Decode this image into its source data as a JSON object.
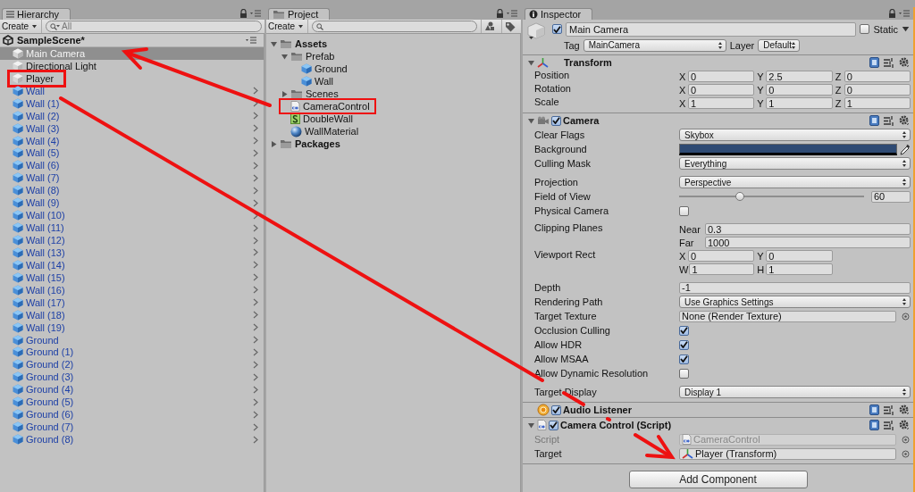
{
  "hierarchy": {
    "tab": "Hierarchy",
    "create": "Create",
    "search": {
      "placeholder": "All"
    },
    "scene": "SampleScene*",
    "items": [
      {
        "name": "Main Camera",
        "kind": "object",
        "selected": true,
        "highlighted": false
      },
      {
        "name": "Directional Light",
        "kind": "object",
        "selected": false,
        "highlighted": false
      },
      {
        "name": "Player",
        "kind": "object",
        "selected": false,
        "highlighted": true
      },
      {
        "name": "Wall",
        "kind": "prefab",
        "selected": false,
        "highlighted": false
      },
      {
        "name": "Wall (1)",
        "kind": "prefab",
        "selected": false,
        "highlighted": false
      },
      {
        "name": "Wall (2)",
        "kind": "prefab",
        "selected": false,
        "highlighted": false
      },
      {
        "name": "Wall (3)",
        "kind": "prefab",
        "selected": false,
        "highlighted": false
      },
      {
        "name": "Wall (4)",
        "kind": "prefab",
        "selected": false,
        "highlighted": false
      },
      {
        "name": "Wall (5)",
        "kind": "prefab",
        "selected": false,
        "highlighted": false
      },
      {
        "name": "Wall (6)",
        "kind": "prefab",
        "selected": false,
        "highlighted": false
      },
      {
        "name": "Wall (7)",
        "kind": "prefab",
        "selected": false,
        "highlighted": false
      },
      {
        "name": "Wall (8)",
        "kind": "prefab",
        "selected": false,
        "highlighted": false
      },
      {
        "name": "Wall (9)",
        "kind": "prefab",
        "selected": false,
        "highlighted": false
      },
      {
        "name": "Wall (10)",
        "kind": "prefab",
        "selected": false,
        "highlighted": false
      },
      {
        "name": "Wall (11)",
        "kind": "prefab",
        "selected": false,
        "highlighted": false
      },
      {
        "name": "Wall (12)",
        "kind": "prefab",
        "selected": false,
        "highlighted": false
      },
      {
        "name": "Wall (13)",
        "kind": "prefab",
        "selected": false,
        "highlighted": false
      },
      {
        "name": "Wall (14)",
        "kind": "prefab",
        "selected": false,
        "highlighted": false
      },
      {
        "name": "Wall (15)",
        "kind": "prefab",
        "selected": false,
        "highlighted": false
      },
      {
        "name": "Wall (16)",
        "kind": "prefab",
        "selected": false,
        "highlighted": false
      },
      {
        "name": "Wall (17)",
        "kind": "prefab",
        "selected": false,
        "highlighted": false
      },
      {
        "name": "Wall (18)",
        "kind": "prefab",
        "selected": false,
        "highlighted": false
      },
      {
        "name": "Wall (19)",
        "kind": "prefab",
        "selected": false,
        "highlighted": false
      },
      {
        "name": "Ground",
        "kind": "prefab",
        "selected": false,
        "highlighted": false
      },
      {
        "name": "Ground (1)",
        "kind": "prefab",
        "selected": false,
        "highlighted": false
      },
      {
        "name": "Ground (2)",
        "kind": "prefab",
        "selected": false,
        "highlighted": false
      },
      {
        "name": "Ground (3)",
        "kind": "prefab",
        "selected": false,
        "highlighted": false
      },
      {
        "name": "Ground (4)",
        "kind": "prefab",
        "selected": false,
        "highlighted": false
      },
      {
        "name": "Ground (5)",
        "kind": "prefab",
        "selected": false,
        "highlighted": false
      },
      {
        "name": "Ground (6)",
        "kind": "prefab",
        "selected": false,
        "highlighted": false
      },
      {
        "name": "Ground (7)",
        "kind": "prefab",
        "selected": false,
        "highlighted": false
      },
      {
        "name": "Ground (8)",
        "kind": "prefab",
        "selected": false,
        "highlighted": false
      }
    ]
  },
  "project": {
    "tab": "Project",
    "create": "Create",
    "tree": [
      {
        "name": "Assets",
        "kind": "folder",
        "expanded": true,
        "highlighted": false,
        "children": [
          {
            "name": "Prefab",
            "kind": "folder",
            "expanded": true,
            "highlighted": false,
            "children": [
              {
                "name": "Ground",
                "kind": "prefab",
                "highlighted": false
              },
              {
                "name": "Wall",
                "kind": "prefab",
                "highlighted": false
              }
            ]
          },
          {
            "name": "Scenes",
            "kind": "folder",
            "expanded": false,
            "highlighted": false
          },
          {
            "name": "CameraControl",
            "kind": "csharp",
            "highlighted": true
          },
          {
            "name": "DoubleWall",
            "kind": "script",
            "highlighted": false
          },
          {
            "name": "WallMaterial",
            "kind": "material",
            "highlighted": false
          }
        ]
      },
      {
        "name": "Packages",
        "kind": "folder",
        "expanded": false,
        "highlighted": false
      }
    ]
  },
  "inspector": {
    "tab": "Inspector",
    "object": {
      "active": true,
      "name": "Main Camera",
      "static": false,
      "static_label": "Static",
      "tag_label": "Tag",
      "tag": "MainCamera",
      "layer_label": "Layer",
      "layer": "Default"
    },
    "components": [
      {
        "kind": "transform",
        "title": "Transform",
        "expanded": true,
        "rows": [
          {
            "kind": "vector",
            "label": "Position",
            "lines": [
              [
                {
                  "axis": "X",
                  "value": "0"
                },
                {
                  "axis": "Y",
                  "value": "2.5"
                },
                {
                  "axis": "Z",
                  "value": "0"
                }
              ]
            ]
          },
          {
            "kind": "vector",
            "label": "Rotation",
            "lines": [
              [
                {
                  "axis": "X",
                  "value": "0"
                },
                {
                  "axis": "Y",
                  "value": "0"
                },
                {
                  "axis": "Z",
                  "value": "0"
                }
              ]
            ]
          },
          {
            "kind": "vector",
            "label": "Scale",
            "lines": [
              [
                {
                  "axis": "X",
                  "value": "1"
                },
                {
                  "axis": "Y",
                  "value": "1"
                },
                {
                  "axis": "Z",
                  "value": "1"
                }
              ]
            ]
          }
        ]
      },
      {
        "kind": "camera",
        "title": "Camera",
        "enabled": true,
        "expanded": true,
        "rows": [
          {
            "kind": "dropdown",
            "label": "Clear Flags",
            "value": "Skybox"
          },
          {
            "kind": "color",
            "label": "Background",
            "color": "#2e4a73"
          },
          {
            "kind": "dropdown",
            "label": "Culling Mask",
            "value": "Everything"
          },
          {
            "kind": "space"
          },
          {
            "kind": "dropdown",
            "label": "Projection",
            "value": "Perspective"
          },
          {
            "kind": "slider",
            "label": "Field of View",
            "level": 0.33,
            "value": "60"
          },
          {
            "kind": "checkbox",
            "label": "Physical Camera",
            "checked": false
          },
          {
            "kind": "space"
          },
          {
            "kind": "vector",
            "label": "Clipping Planes",
            "lines": [
              [
                {
                  "axis": "Near",
                  "value": "0.3"
                }
              ],
              [
                {
                  "axis": "Far",
                  "value": "1000"
                }
              ]
            ]
          },
          {
            "kind": "vector",
            "label": "Viewport Rect",
            "lines": [
              [
                {
                  "axis": "X",
                  "value": "0"
                },
                {
                  "axis": "Y",
                  "value": "0"
                }
              ],
              [
                {
                  "axis": "W",
                  "value": "1"
                },
                {
                  "axis": "H",
                  "value": "1"
                }
              ]
            ]
          },
          {
            "kind": "space"
          },
          {
            "kind": "field",
            "label": "Depth",
            "value": "-1"
          },
          {
            "kind": "dropdown",
            "label": "Rendering Path",
            "value": "Use Graphics Settings"
          },
          {
            "kind": "object",
            "label": "Target Texture",
            "value": "None (Render Texture)",
            "disabled": false
          },
          {
            "kind": "checkbox",
            "label": "Occlusion Culling",
            "checked": true
          },
          {
            "kind": "checkbox",
            "label": "Allow HDR",
            "checked": true
          },
          {
            "kind": "checkbox",
            "label": "Allow MSAA",
            "checked": true
          },
          {
            "kind": "checkbox",
            "label": "Allow Dynamic Resolution",
            "checked": false
          },
          {
            "kind": "space"
          },
          {
            "kind": "dropdown",
            "label": "Target Display",
            "value": "Display 1"
          }
        ]
      },
      {
        "kind": "audio",
        "title": "Audio Listener",
        "enabled": true
      },
      {
        "kind": "script",
        "title": "Camera Control (Script)",
        "enabled": true,
        "expanded": true,
        "rows": [
          {
            "kind": "script_ref",
            "label": "Script",
            "value": "CameraControl",
            "disabled": true
          },
          {
            "kind": "transform_ref",
            "label": "Target",
            "value": "Player (Transform)",
            "disabled": false
          }
        ]
      }
    ],
    "add_component": "Add Component"
  }
}
